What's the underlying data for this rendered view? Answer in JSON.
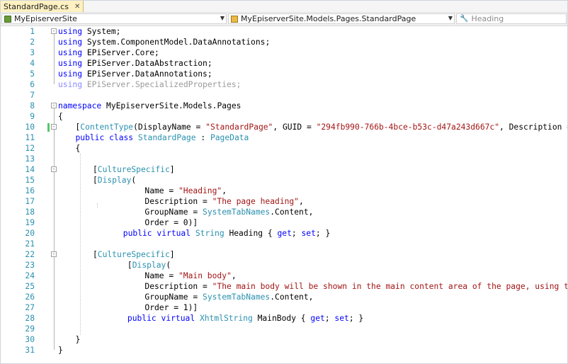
{
  "tab": {
    "title": "StandardPage.cs",
    "close_glyph": "✕"
  },
  "navbar": {
    "project": "MyEpiserverSite",
    "type_scope": "MyEpiserverSite.Models.Pages.StandardPage",
    "member_placeholder": "Heading"
  },
  "colors": {
    "keyword": "#0000ff",
    "type": "#2b91af",
    "string": "#a31515",
    "line_number": "#2b91af",
    "change_marker": "#57c66a",
    "active_tab": "#fff1c1"
  },
  "code_lines": [
    {
      "n": "1",
      "indent": 0,
      "fold": "-",
      "marker": false,
      "tokens": [
        [
          "kw",
          "using"
        ],
        [
          "p",
          " System;"
        ]
      ]
    },
    {
      "n": "2",
      "indent": 0,
      "marker": false,
      "tokens": [
        [
          "kw",
          "using"
        ],
        [
          "p",
          " System.ComponentModel.DataAnnotations;"
        ]
      ]
    },
    {
      "n": "3",
      "indent": 0,
      "marker": false,
      "tokens": [
        [
          "kw",
          "using"
        ],
        [
          "p",
          " EPiServer.Core;"
        ]
      ]
    },
    {
      "n": "4",
      "indent": 0,
      "marker": false,
      "tokens": [
        [
          "kw",
          "using"
        ],
        [
          "p",
          " EPiServer.DataAbstraction;"
        ]
      ]
    },
    {
      "n": "5",
      "indent": 0,
      "marker": false,
      "tokens": [
        [
          "kw",
          "using"
        ],
        [
          "p",
          " EPiServer.DataAnnotations;"
        ]
      ]
    },
    {
      "n": "6",
      "indent": 0,
      "marker": false,
      "tokens": [
        [
          "dimkw",
          "using"
        ],
        [
          "dim",
          " EPiServer.SpecializedProperties;"
        ]
      ]
    },
    {
      "n": "7",
      "indent": 0,
      "marker": false,
      "tokens": []
    },
    {
      "n": "8",
      "indent": 0,
      "fold": "-",
      "marker": false,
      "tokens": [
        [
          "kw",
          "namespace"
        ],
        [
          "p",
          " MyEpiserverSite.Models.Pages"
        ]
      ]
    },
    {
      "n": "9",
      "indent": 0,
      "marker": false,
      "tokens": [
        [
          "p",
          "{"
        ]
      ]
    },
    {
      "n": "10",
      "indent": 4,
      "fold": "-",
      "marker": true,
      "tokens": [
        [
          "p",
          "["
        ],
        [
          "ty",
          "ContentType"
        ],
        [
          "p",
          "(DisplayName = "
        ],
        [
          "st",
          "\"StandardPage\""
        ],
        [
          "p",
          ", GUID = "
        ],
        [
          "st",
          "\"294fb990-766b-4bce-b53c-d47a243d667c\""
        ],
        [
          "p",
          ", Description = "
        ],
        [
          "st",
          "\"\""
        ],
        [
          "p",
          ")]"
        ]
      ]
    },
    {
      "n": "11",
      "indent": 4,
      "marker": false,
      "tokens": [
        [
          "kw",
          "public"
        ],
        [
          "p",
          " "
        ],
        [
          "kw",
          "class"
        ],
        [
          "p",
          " "
        ],
        [
          "ty",
          "StandardPage"
        ],
        [
          "p",
          " : "
        ],
        [
          "ty",
          "PageData"
        ]
      ]
    },
    {
      "n": "12",
      "indent": 4,
      "marker": false,
      "tokens": [
        [
          "p",
          "{"
        ]
      ]
    },
    {
      "n": "13",
      "indent": 0,
      "marker": false,
      "tokens": []
    },
    {
      "n": "14",
      "indent": 8,
      "fold": "-",
      "marker": false,
      "tokens": [
        [
          "p",
          "["
        ],
        [
          "ty",
          "CultureSpecific"
        ],
        [
          "p",
          "]"
        ]
      ]
    },
    {
      "n": "15",
      "indent": 8,
      "marker": false,
      "tokens": [
        [
          "p",
          "["
        ],
        [
          "ty",
          "Display"
        ],
        [
          "p",
          "("
        ]
      ]
    },
    {
      "n": "16",
      "indent": 20,
      "marker": false,
      "tokens": [
        [
          "p",
          "Name = "
        ],
        [
          "st",
          "\"Heading\""
        ],
        [
          "p",
          ","
        ]
      ]
    },
    {
      "n": "17",
      "indent": 20,
      "marker": false,
      "tokens": [
        [
          "p",
          "Description = "
        ],
        [
          "st",
          "\"The page heading\""
        ],
        [
          "p",
          ","
        ]
      ]
    },
    {
      "n": "18",
      "indent": 20,
      "marker": false,
      "tokens": [
        [
          "p",
          "GroupName = "
        ],
        [
          "ty",
          "SystemTabNames"
        ],
        [
          "p",
          ".Content,"
        ]
      ]
    },
    {
      "n": "19",
      "indent": 20,
      "marker": false,
      "tokens": [
        [
          "p",
          "Order = 0)]"
        ]
      ]
    },
    {
      "n": "20",
      "indent": 15,
      "marker": false,
      "tokens": [
        [
          "kw",
          "public"
        ],
        [
          "p",
          " "
        ],
        [
          "kw",
          "virtual"
        ],
        [
          "p",
          " "
        ],
        [
          "ty",
          "String"
        ],
        [
          "p",
          " Heading { "
        ],
        [
          "kw",
          "get"
        ],
        [
          "p",
          "; "
        ],
        [
          "kw",
          "set"
        ],
        [
          "p",
          "; }"
        ]
      ]
    },
    {
      "n": "21",
      "indent": 0,
      "marker": false,
      "tokens": []
    },
    {
      "n": "22",
      "indent": 8,
      "fold": "-",
      "marker": false,
      "tokens": [
        [
          "p",
          "["
        ],
        [
          "ty",
          "CultureSpecific"
        ],
        [
          "p",
          "]"
        ]
      ]
    },
    {
      "n": "23",
      "indent": 16,
      "marker": false,
      "tokens": [
        [
          "p",
          "["
        ],
        [
          "ty",
          "Display"
        ],
        [
          "p",
          "("
        ]
      ]
    },
    {
      "n": "24",
      "indent": 20,
      "marker": false,
      "tokens": [
        [
          "p",
          "Name = "
        ],
        [
          "st",
          "\"Main body\""
        ],
        [
          "p",
          ","
        ]
      ]
    },
    {
      "n": "25",
      "indent": 20,
      "marker": false,
      "tokens": [
        [
          "p",
          "Description = "
        ],
        [
          "st",
          "\"The main body will be shown in the main content area of the page, using the XHTML"
        ]
      ]
    },
    {
      "n": "26",
      "indent": 20,
      "marker": false,
      "tokens": [
        [
          "p",
          "GroupName = "
        ],
        [
          "ty",
          "SystemTabNames"
        ],
        [
          "p",
          ".Content,"
        ]
      ]
    },
    {
      "n": "27",
      "indent": 20,
      "marker": false,
      "tokens": [
        [
          "p",
          "Order = 1)]"
        ]
      ]
    },
    {
      "n": "28",
      "indent": 16,
      "marker": false,
      "tokens": [
        [
          "kw",
          "public"
        ],
        [
          "p",
          " "
        ],
        [
          "kw",
          "virtual"
        ],
        [
          "p",
          " "
        ],
        [
          "ty",
          "XhtmlString"
        ],
        [
          "p",
          " MainBody { "
        ],
        [
          "kw",
          "get"
        ],
        [
          "p",
          "; "
        ],
        [
          "kw",
          "set"
        ],
        [
          "p",
          "; }"
        ]
      ]
    },
    {
      "n": "29",
      "indent": 0,
      "marker": false,
      "tokens": []
    },
    {
      "n": "30",
      "indent": 4,
      "marker": false,
      "tokens": [
        [
          "p",
          "}"
        ]
      ]
    },
    {
      "n": "31",
      "indent": 0,
      "marker": false,
      "tokens": [
        [
          "p",
          "}"
        ]
      ]
    }
  ]
}
